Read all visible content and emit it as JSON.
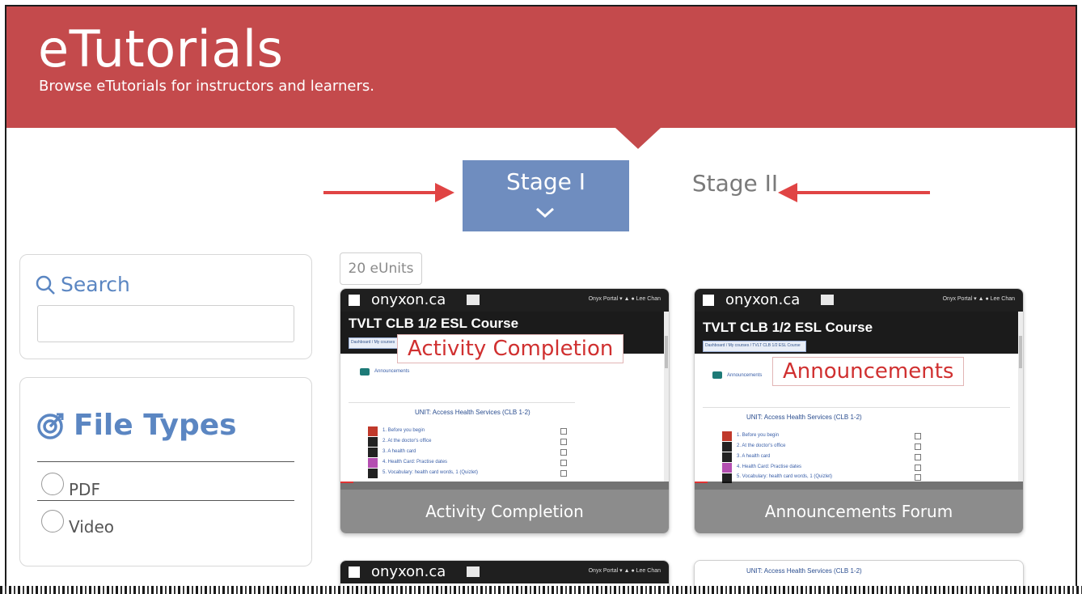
{
  "header": {
    "title": "eTutorials",
    "subtitle": "Browse eTutorials for instructors and learners."
  },
  "stages": [
    {
      "label": "Stage I",
      "active": true
    },
    {
      "label": "Stage II",
      "active": false
    }
  ],
  "search": {
    "label": "Search",
    "value": "",
    "placeholder": ""
  },
  "file_types": {
    "title": "File Types",
    "options": [
      {
        "label": "PDF",
        "checked": false
      },
      {
        "label": "Video",
        "checked": false
      }
    ]
  },
  "units_count": "20 eUnits",
  "cards": [
    {
      "caption": "Activity Completion",
      "overlay": "Activity Completion",
      "thumb": {
        "logo": "onyxon.ca",
        "course_title": "TVLT CLB 1/2 ESL Course",
        "breadcrumb": "Dashboard / My courses",
        "portal_menu": "Onyx Portal",
        "user": "Lee Chan",
        "announcements": "Announcements",
        "unit_heading": "UNIT: Access Health Services (CLB 1-2)",
        "rows": [
          "1. Before you begin",
          "2. At the doctor's office",
          "3. A health card",
          "4. Health Card: Practise dates",
          "5. Vocabulary: health card words, 1 (Quizlet)"
        ]
      }
    },
    {
      "caption": "Announcements Forum",
      "overlay": "Announcements",
      "thumb": {
        "logo": "onyxon.ca",
        "course_title": "TVLT CLB 1/2 ESL Course",
        "breadcrumb": "Dashboard / My courses / TVLT CLB 1/2 ESL Course",
        "portal_menu": "Onyx Portal",
        "user": "Lee Chan",
        "announcements": "Announcements",
        "unit_heading": "UNIT: Access Health Services (CLB 1-2)",
        "rows": [
          "1. Before you begin",
          "2. At the doctor's office",
          "3. A health card",
          "4. Health Card: Practise dates",
          "5. Vocabulary: health card words, 1 (Quizlet)"
        ]
      }
    },
    {
      "thumb": {
        "logo": "onyxon.ca",
        "portal_menu": "Onyx Portal",
        "user": "Lee Chan"
      }
    },
    {
      "thumb": {
        "unit_heading": "UNIT: Access Health Services (CLB 1-2)"
      }
    }
  ],
  "colors": {
    "banner": "#c44a4c",
    "stage_active": "#6f8dbf",
    "accent_text": "#5b86c2",
    "annotation_arrow": "#e04444",
    "card_caption_bg": "#8c8c8c"
  },
  "icons": [
    "search-icon",
    "file-types-icon",
    "chevron-down-icon",
    "arrow-right-icon",
    "arrow-left-icon"
  ]
}
